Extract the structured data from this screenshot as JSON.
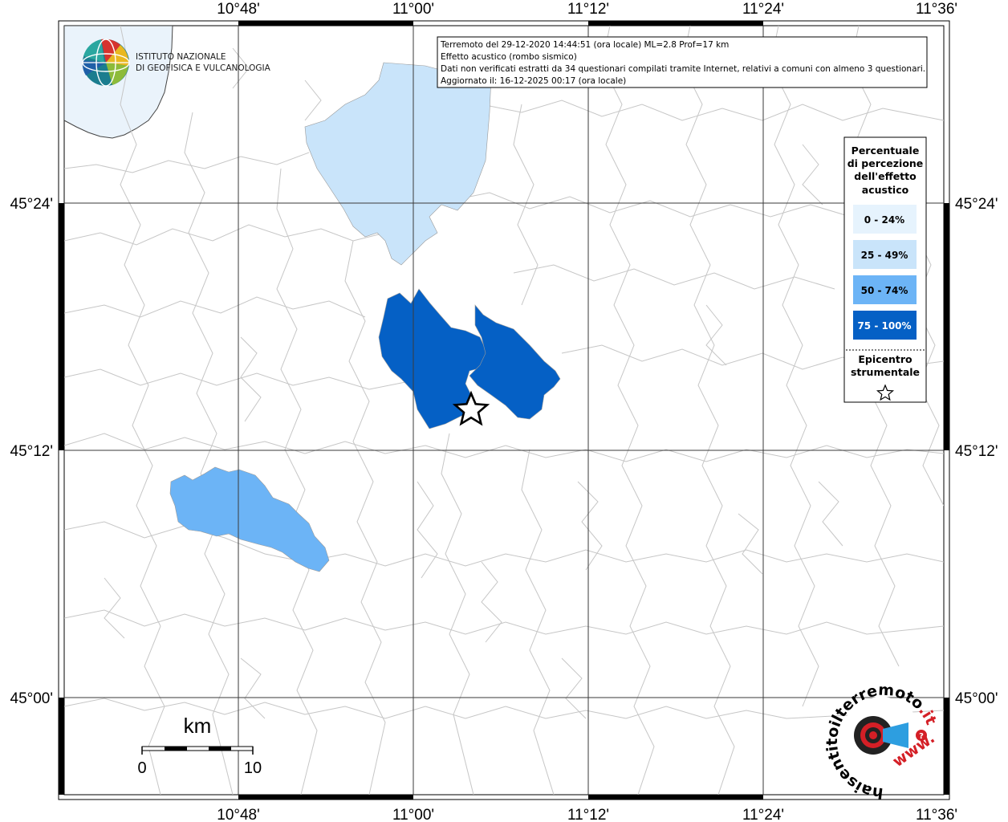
{
  "info_box": {
    "line1": "Terremoto del 29-12-2020 14:44:51 (ora locale) ML=2.8 Prof=17 km",
    "line2": "Effetto acustico (rombo sismico)",
    "line3": "Dati non verificati estratti da 34 questionari compilati tramite Internet, relativi a comuni con almeno 3 questionari.",
    "line4": "Aggiornato il: 16-12-2025 00:17 (ora locale)"
  },
  "axes": {
    "lon_labels": [
      "10°48'",
      "11°00'",
      "11°12'",
      "11°24'",
      "11°36'"
    ],
    "lat_labels": [
      "45°24'",
      "45°12'",
      "45°00'"
    ]
  },
  "logo": {
    "line1": "ISTITUTO NAZIONALE",
    "line2": "DI GEOFISICA E VULCANOLOGIA"
  },
  "legend": {
    "title_lines": [
      "Percentuale",
      "di percezione",
      "dell'effetto",
      "acustico"
    ],
    "classes": [
      {
        "label": "0 - 24%",
        "color": "#e6f3fd",
        "text_color": "#000000"
      },
      {
        "label": "25 - 49%",
        "color": "#c9e4fa",
        "text_color": "#000000"
      },
      {
        "label": "50 - 74%",
        "color": "#6cb4f6",
        "text_color": "#000000"
      },
      {
        "label": "75 - 100%",
        "color": "#0560c5",
        "text_color": "#ffffff"
      }
    ],
    "epicenter_lines": [
      "Epicentro",
      "strumentale"
    ],
    "epicenter_symbol": "☆"
  },
  "scale_bar": {
    "unit": "km",
    "min_label": "0",
    "max_label": "10"
  },
  "hsit_logo": {
    "circular_text_a": "haisentitoilterremoto",
    "circular_text_b": ".it",
    "circular_text_c": "www."
  },
  "colors": {
    "grid": "#3a3a3a",
    "boundaries": "#c6c6c6",
    "sea": "#eaf3fb",
    "class_25_49": "#c9e4fa",
    "class_50_74": "#6cb4f6",
    "class_75_100": "#0560c5"
  }
}
